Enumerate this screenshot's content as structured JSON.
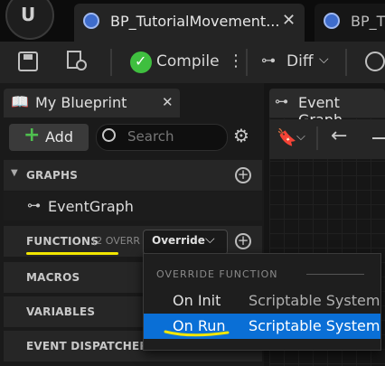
{
  "tabs": [
    {
      "label": "BP_TutorialMovement..."
    },
    {
      "label": "BP_T"
    }
  ],
  "toolbar": {
    "compile_label": "Compile",
    "diff_label": "Diff"
  },
  "my_blueprint": {
    "title": "My Blueprint",
    "add_label": "Add",
    "search_placeholder": "Search",
    "sections": {
      "graphs": "GRAPHS",
      "event_graph": "EventGraph",
      "functions": "FUNCTIONS",
      "functions_count": "(2 OVERR",
      "override_label": "Override",
      "macros": "MACROS",
      "variables": "VARIABLES",
      "event_dispatchers": "EVENT DISPATCHERS"
    }
  },
  "graph_tab": {
    "label": "Event Graph"
  },
  "override_menu": {
    "header": "OVERRIDE FUNCTION",
    "items": [
      {
        "name": "On Init",
        "source": "Scriptable System"
      },
      {
        "name": "On Run",
        "source": "Scriptable System"
      }
    ]
  },
  "colors": {
    "accent_selected": "#0a6fd6",
    "annotation_underline": "#f2e600",
    "compile_success": "#3fbf3f",
    "add_plus": "#4fc04f"
  }
}
